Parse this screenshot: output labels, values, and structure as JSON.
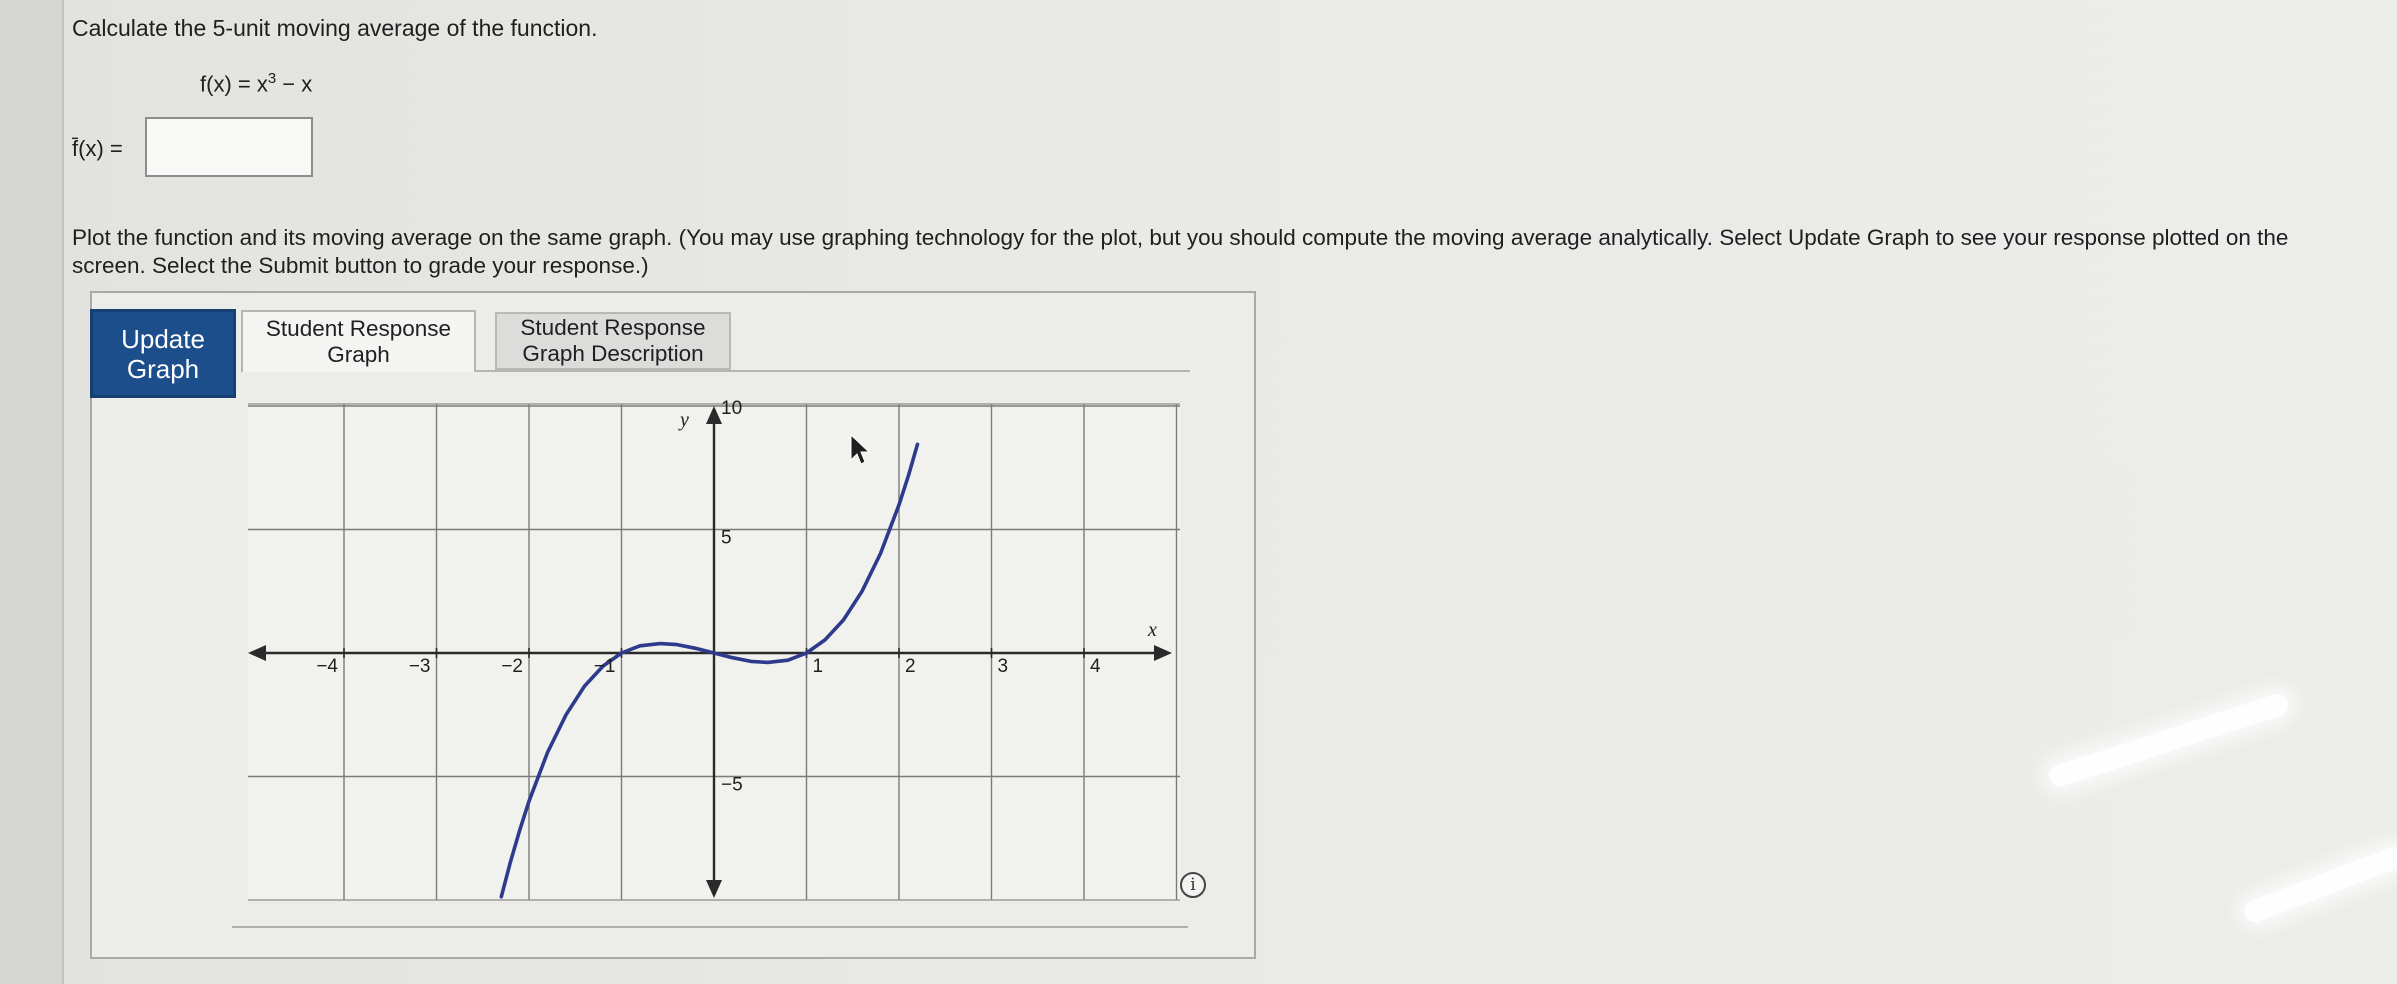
{
  "question": {
    "line1": "Calculate the 5-unit moving average of the function.",
    "function": "f(x) = x",
    "function_exp": "3",
    "function_tail": " − x",
    "answer_label": "f̄(x) =",
    "answer_value": "",
    "answer_placeholder": "",
    "instructions": "Plot the function and its moving average on the same graph. (You may use graphing technology for the plot, but you should compute the moving average analytically. Select Update Graph to see your response plotted on the screen. Select the Submit button to grade your response.)"
  },
  "toolbar": {
    "update_label": "Update Graph",
    "tabs": [
      {
        "label": "Student Response Graph",
        "active": true
      },
      {
        "label": "Student Response Graph Description",
        "active": false
      }
    ]
  },
  "chart_data": {
    "type": "line",
    "xlabel": "x",
    "ylabel": "y",
    "xlim": [
      -5,
      5
    ],
    "ylim": [
      -10,
      10
    ],
    "grid": true,
    "x_ticks": [
      {
        "value": -4,
        "label": "−4"
      },
      {
        "value": -3,
        "label": "−3"
      },
      {
        "value": -2,
        "label": "−2"
      },
      {
        "value": -1,
        "label": "−1"
      },
      {
        "value": 1,
        "label": "1"
      },
      {
        "value": 2,
        "label": "2"
      },
      {
        "value": 3,
        "label": "3"
      },
      {
        "value": 4,
        "label": "4"
      }
    ],
    "y_ticks": [
      {
        "value": 10,
        "label": "10"
      },
      {
        "value": 5,
        "label": "5"
      },
      {
        "value": -5,
        "label": "−5"
      }
    ],
    "series": [
      {
        "color": "#2e3a8c",
        "x": [
          -2.3,
          -2.2,
          -2.1,
          -2.0,
          -1.8,
          -1.6,
          -1.4,
          -1.2,
          -1.0,
          -0.8,
          -0.58,
          -0.4,
          -0.2,
          0.0,
          0.2,
          0.4,
          0.58,
          0.8,
          1.0,
          1.2,
          1.4,
          1.6,
          1.8,
          2.0,
          2.1,
          2.2
        ],
        "y": [
          -9.87,
          -8.45,
          -7.16,
          -6.0,
          -4.03,
          -2.5,
          -1.34,
          -0.53,
          0.0,
          0.29,
          0.38,
          0.34,
          0.19,
          0.0,
          -0.19,
          -0.34,
          -0.38,
          -0.29,
          0.0,
          0.53,
          1.34,
          2.5,
          4.03,
          6.0,
          7.16,
          8.45
        ]
      }
    ]
  },
  "info_icon": "info-icon",
  "cursor_icon": "mouse-pointer-icon"
}
